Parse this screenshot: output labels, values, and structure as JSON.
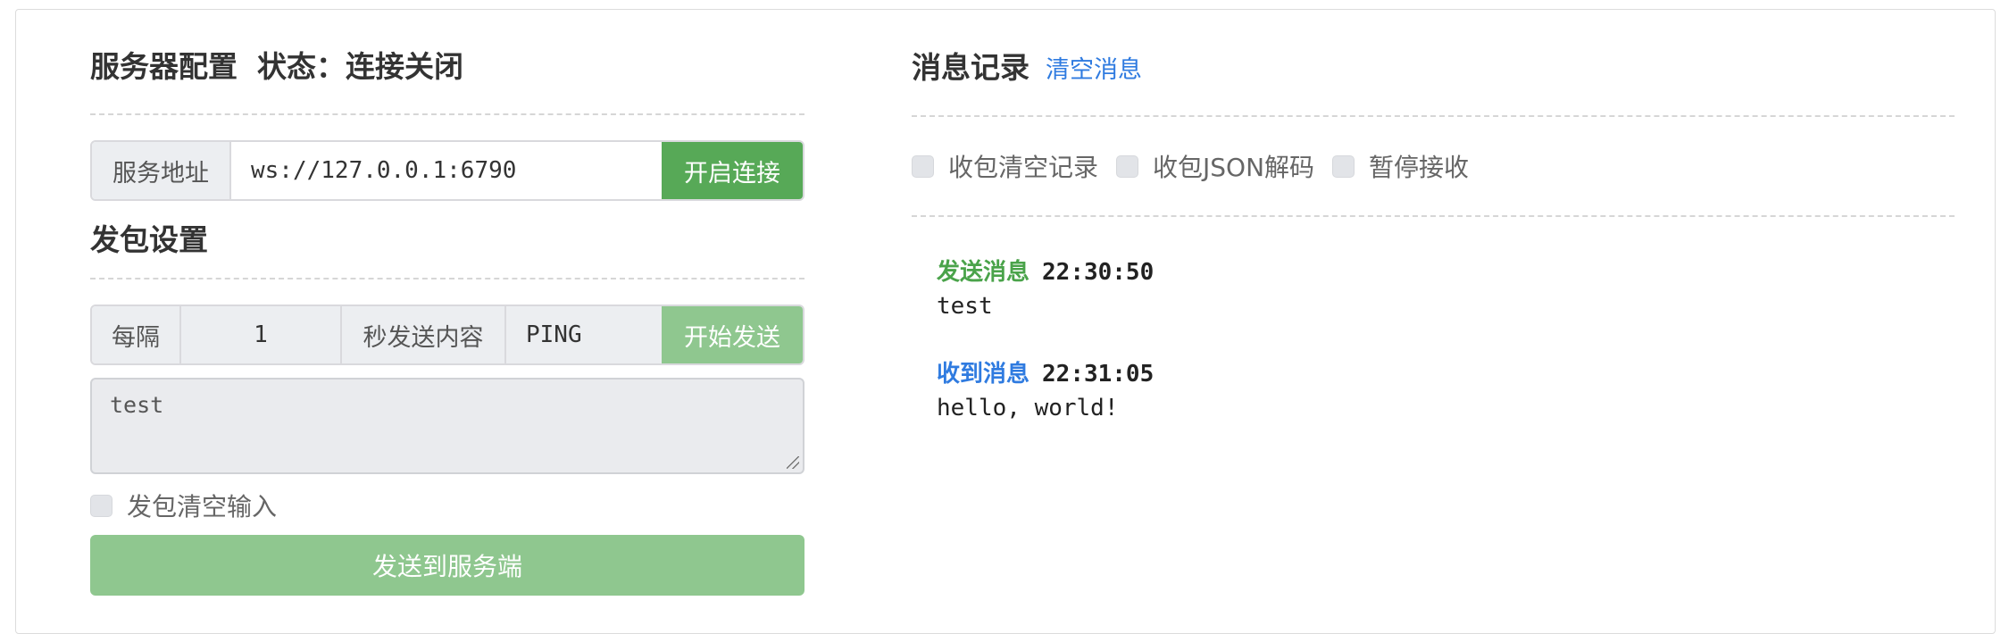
{
  "server": {
    "title": "服务器配置",
    "status_label": "状态：",
    "status_value": "连接关闭",
    "address_label": "服务地址",
    "address_value": "ws://127.0.0.1:6790",
    "connect_label": "开启连接"
  },
  "send_settings": {
    "title": "发包设置",
    "every_label": "每隔",
    "interval_value": "1",
    "seconds_content_label": "秒发送内容",
    "content_value": "PING",
    "start_label": "开始发送",
    "message_text": "test",
    "clear_input_label": "发包清空输入",
    "send_button_label": "发送到服务端"
  },
  "log": {
    "title": "消息记录",
    "clear_link": "清空消息",
    "options": [
      {
        "label": "收包清空记录",
        "checked": false
      },
      {
        "label": "收包JSON解码",
        "checked": false
      },
      {
        "label": "暂停接收",
        "checked": false
      }
    ],
    "messages": [
      {
        "kind": "发送消息",
        "time": "22:30:50",
        "body": "test"
      },
      {
        "kind": "收到消息",
        "time": "22:31:05",
        "body": "hello, world!"
      }
    ]
  },
  "colors": {
    "primary_green": "#57a957",
    "disabled_green": "#8fc78f",
    "link_blue": "#2f7be0"
  }
}
